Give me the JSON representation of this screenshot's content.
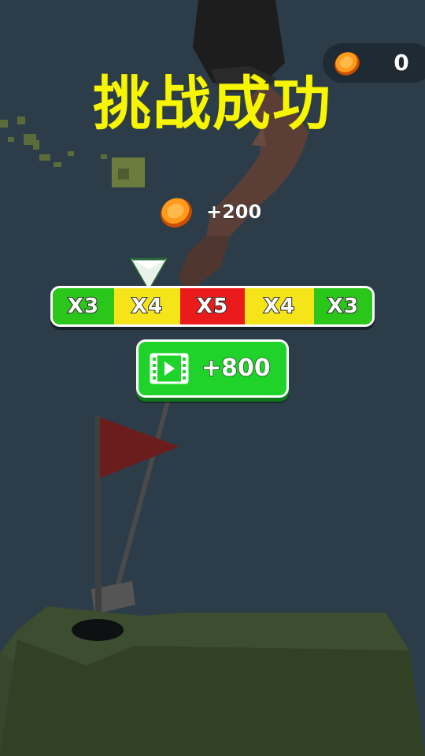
{
  "hud": {
    "coin_count": "0",
    "coin_icon": "coin-icon"
  },
  "result": {
    "title": "挑战成功",
    "reward_amount": "+200"
  },
  "multiplier": {
    "segments": [
      {
        "label": "X3",
        "color": "#2bc61a"
      },
      {
        "label": "X4",
        "color": "#f6e41b"
      },
      {
        "label": "X5",
        "color": "#ec1b1b"
      },
      {
        "label": "X4",
        "color": "#f6e41b"
      },
      {
        "label": "X3",
        "color": "#2bc61a"
      }
    ]
  },
  "video_button": {
    "label": "+800",
    "icon": "video-play-icon"
  },
  "colors": {
    "title": "#f7f500",
    "background": "#2c3d49",
    "button_green": "#1fd32b"
  }
}
